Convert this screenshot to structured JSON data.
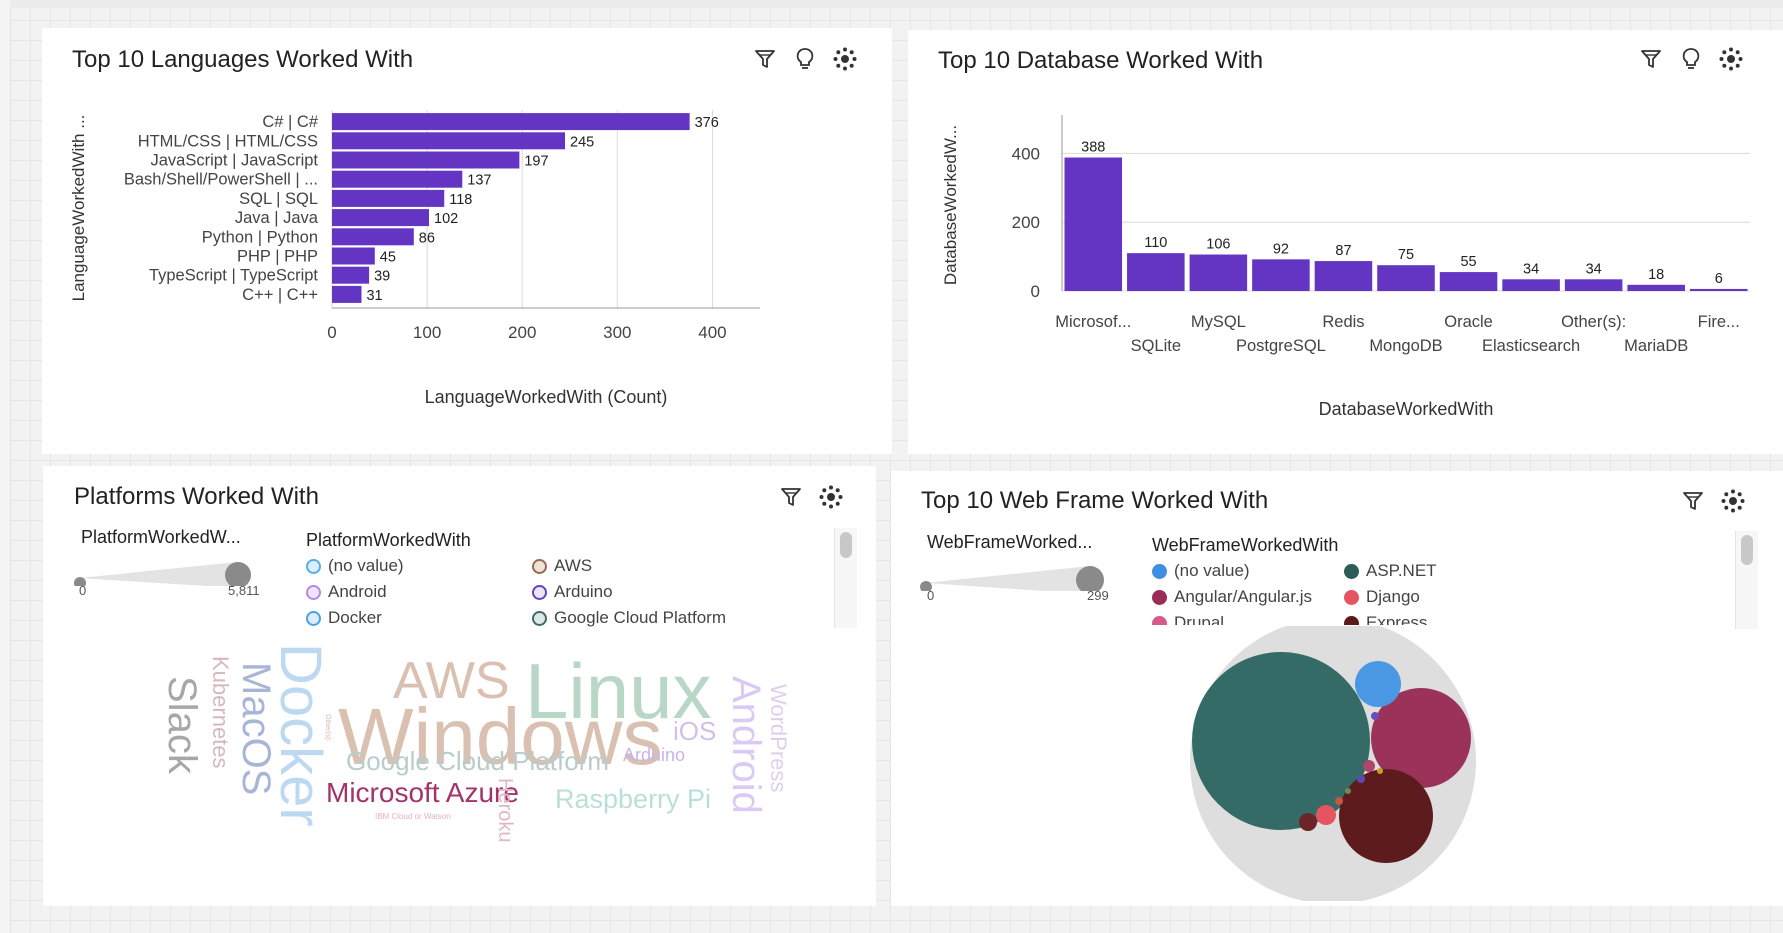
{
  "colors": {
    "bar": "#6335c2",
    "grid": "#d9d9d9",
    "axis": "#9a9a9a",
    "text": "#444444"
  },
  "panel_lang": {
    "title": "Top 10 Languages Worked With",
    "icons": [
      "filter-icon",
      "lightbulb-icon",
      "settings-icon"
    ]
  },
  "panel_db": {
    "title": "Top 10 Database Worked With",
    "icons": [
      "filter-icon",
      "lightbulb-icon",
      "settings-icon"
    ]
  },
  "panel_platform": {
    "title": "Platforms Worked With",
    "size_label": "PlatformWorkedW...",
    "size_min": "0",
    "size_max": "5,811",
    "legend_title": "PlatformWorkedWith",
    "legend": [
      {
        "label": "(no value)",
        "color": "#8ec6ee"
      },
      {
        "label": "AWS",
        "color": "#b98a6e"
      },
      {
        "label": "Android",
        "color": "#c9a7ec"
      },
      {
        "label": "Arduino",
        "color": "#7b4fc9"
      },
      {
        "label": "Docker",
        "color": "#64b0e6"
      },
      {
        "label": "Google Cloud Platform",
        "color": "#4f7d77"
      }
    ],
    "words": [
      "Linux",
      "Windows",
      "AWS",
      "Docker",
      "MacOS",
      "Slack",
      "Kubernetes",
      "Android",
      "WordPress",
      "iOS",
      "Arduino",
      "Google Cloud Platform",
      "Microsoft Azure",
      "Raspberry Pi",
      "Heroku",
      "IBM Cloud or Watson",
      "Other(s):"
    ]
  },
  "panel_web": {
    "title": "Top 10 Web Frame Worked With",
    "size_label": "WebFrameWorked...",
    "size_min": "0",
    "size_max": "299",
    "legend_title": "WebFrameWorkedWith",
    "legend": [
      {
        "label": "(no value)",
        "color": "#3d8fe0"
      },
      {
        "label": "ASP.NET",
        "color": "#2d5b58"
      },
      {
        "label": "Angular/Angular.js",
        "color": "#9a2d57"
      },
      {
        "label": "Django",
        "color": "#e55561"
      },
      {
        "label": "Drupal",
        "color": "#d8598a"
      },
      {
        "label": "Express",
        "color": "#5b1a1a"
      }
    ]
  },
  "chart_data": [
    {
      "type": "bar",
      "orientation": "horizontal",
      "title": "Top 10 Languages Worked With",
      "xlabel": "LanguageWorkedWith (Count)",
      "ylabel": "LanguageWorkedWith ...",
      "categories": [
        "C# | C#",
        "HTML/CSS | HTML/CSS",
        "JavaScript | JavaScript",
        "Bash/Shell/PowerShell | ...",
        "SQL | SQL",
        "Java | Java",
        "Python | Python",
        "PHP | PHP",
        "TypeScript | TypeScript",
        "C++ | C++"
      ],
      "values": [
        376,
        245,
        197,
        137,
        118,
        102,
        86,
        45,
        39,
        31
      ],
      "xticks": [
        "0",
        "100",
        "200",
        "300",
        "400"
      ],
      "xlim": [
        0,
        450
      ],
      "grid": true
    },
    {
      "type": "bar",
      "orientation": "vertical",
      "title": "Top 10 Database Worked With",
      "xlabel": "DatabaseWorkedWith",
      "ylabel": "DatabaseWorkedW...",
      "categories": [
        "Microsof...",
        "SQLite",
        "MySQL",
        "PostgreSQL",
        "Redis",
        "MongoDB",
        "Oracle",
        "Elasticsearch",
        "Other(s):",
        "MariaDB",
        "Fire..."
      ],
      "values": [
        388,
        110,
        106,
        92,
        87,
        75,
        55,
        34,
        34,
        18,
        6
      ],
      "yticks": [
        "0",
        "200",
        "400"
      ],
      "ylim": [
        0,
        500
      ],
      "grid": true
    },
    {
      "type": "bubble",
      "title": "Top 10 Web Frame Worked With",
      "series": [
        {
          "name": "ASP.NET",
          "value": 299
        },
        {
          "name": "Angular/Angular.js",
          "value": 97
        },
        {
          "name": "Express",
          "value": 91
        },
        {
          "name": "(no value)",
          "value": 21
        }
      ]
    }
  ]
}
